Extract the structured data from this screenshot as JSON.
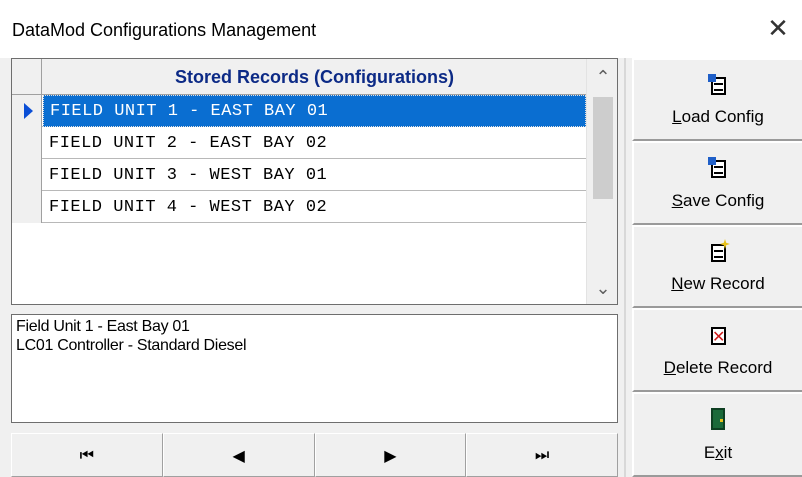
{
  "window": {
    "title": "DataMod Configurations Management",
    "close_glyph": "✕"
  },
  "grid": {
    "header": "Stored Records (Configurations)",
    "rows": [
      "FIELD UNIT 1 - EAST BAY 01",
      "FIELD UNIT 2 - EAST BAY 02",
      "FIELD UNIT 3 - WEST BAY 01",
      "FIELD UNIT 4 - WEST BAY 02"
    ],
    "selected_row": 0,
    "scroll_up_glyph": "⌃",
    "scroll_down_glyph": "⌄"
  },
  "memo": {
    "line1": "Field Unit 1 - East Bay 01",
    "line2": "LC01 Controller - Standard Diesel"
  },
  "navigator": {
    "first": "⏮",
    "prior": "◀",
    "next": "▶",
    "last": "⏭"
  },
  "buttons": {
    "load": {
      "accel": "L",
      "rest": "oad Config",
      "icon": "load-document-icon"
    },
    "save": {
      "accel": "S",
      "rest": "ave Config",
      "icon": "save-document-icon"
    },
    "new": {
      "accel": "N",
      "rest": "ew Record",
      "icon": "new-document-icon"
    },
    "delete": {
      "accel": "D",
      "rest": "elete Record",
      "icon": "delete-document-icon"
    },
    "exit": {
      "pre": "E",
      "accel": "x",
      "rest": "it",
      "icon": "exit-door-icon"
    }
  },
  "colors": {
    "selection": "#0a6ed1",
    "header_text": "#0c2a86",
    "indicator": "#0b4fd6"
  }
}
